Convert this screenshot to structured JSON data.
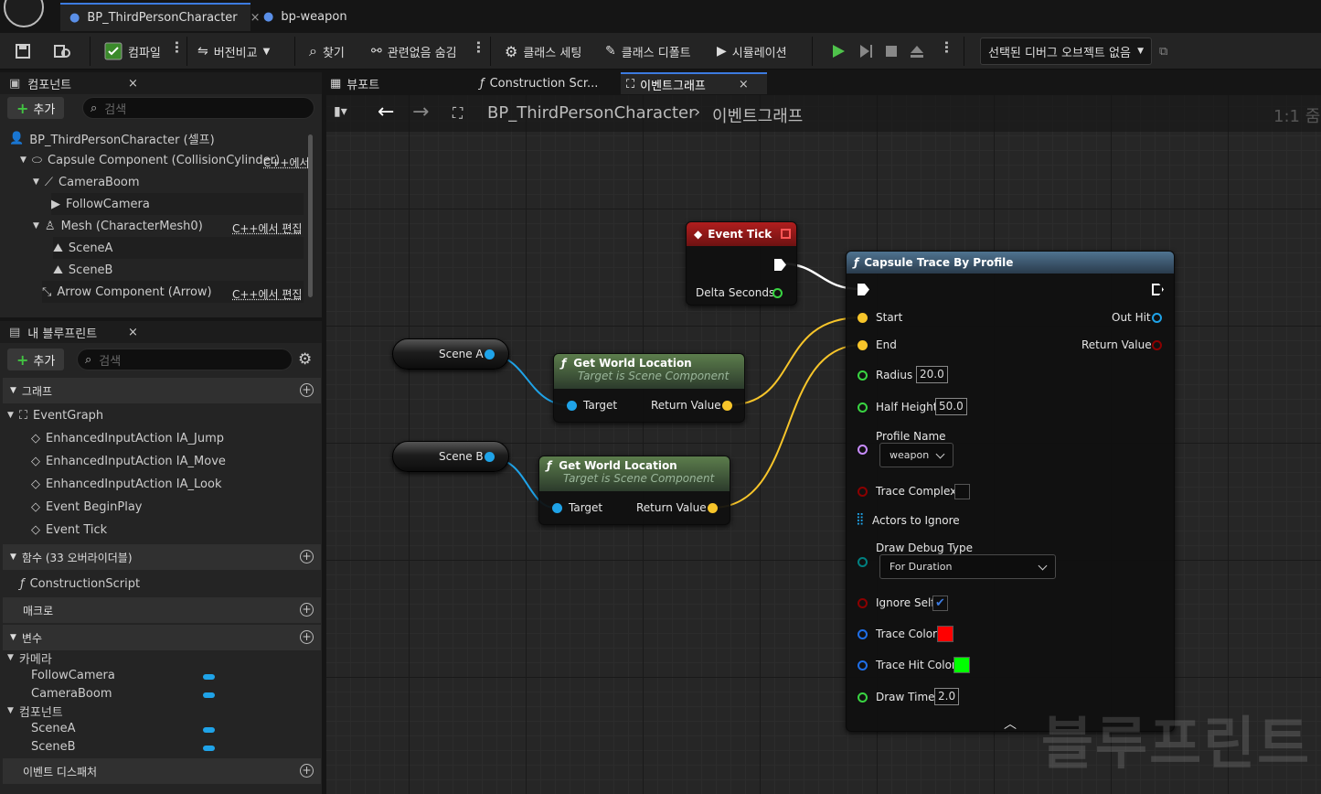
{
  "tabs": [
    {
      "label": "BP_ThirdPersonCharacter",
      "close": "×"
    },
    {
      "label": "bp-weapon"
    }
  ],
  "toolbar": {
    "compile": "컴파일",
    "diff": "버전비교",
    "find": "찾기",
    "hide_unrelated": "관련없음 숨김",
    "class_settings": "클래스 세팅",
    "class_defaults": "클래스 디폴트",
    "simulation": "시뮬레이션",
    "debug_object": "선택된 디버그 오브젝트 없음"
  },
  "components_panel": {
    "title": "컴포넌트",
    "add": "추가",
    "search_placeholder": "검색",
    "items": [
      {
        "label": "BP_ThirdPersonCharacter (셀프)"
      },
      {
        "label": "Capsule Component (CollisionCylinder)",
        "edit": "C++에서"
      },
      {
        "label": "CameraBoom"
      },
      {
        "label": "FollowCamera"
      },
      {
        "label": "Mesh (CharacterMesh0)",
        "edit": "C++에서 편집"
      },
      {
        "label": "SceneA"
      },
      {
        "label": "SceneB"
      },
      {
        "label": "Arrow Component (Arrow)",
        "edit": "C++에서 편집"
      }
    ]
  },
  "my_blueprint": {
    "title": "내 블루프린트",
    "add": "추가",
    "search_placeholder": "검색",
    "graphs_section": "그래프",
    "event_graph": "EventGraph",
    "events": [
      "EnhancedInputAction IA_Jump",
      "EnhancedInputAction IA_Move",
      "EnhancedInputAction IA_Look",
      "Event BeginPlay",
      "Event Tick"
    ],
    "functions_section": "함수 (33 오버라이더블)",
    "construction_script": "ConstructionScript",
    "macros_section": "매크로",
    "variables_section": "변수",
    "categories": [
      {
        "name": "카메라",
        "vars": [
          "FollowCamera",
          "CameraBoom"
        ]
      },
      {
        "name": "컴포넌트",
        "vars": [
          "SceneA",
          "SceneB"
        ]
      }
    ],
    "dispatchers_section": "이벤트 디스패처"
  },
  "editor_tabs": [
    "뷰포트",
    "Construction Scr...",
    "이벤트그래프"
  ],
  "breadcrumb": {
    "root": "BP_ThirdPersonCharacter",
    "current": "이벤트그래프",
    "zoom": "1:1 줌"
  },
  "watermark": "블루프린트",
  "nodes": {
    "event_tick": {
      "title": "Event Tick",
      "pin": "Delta Seconds"
    },
    "scene_a": "Scene A",
    "scene_b": "Scene B",
    "gwl": {
      "title": "Get World Location",
      "subtitle": "Target is Scene Component",
      "target": "Target",
      "ret": "Return Value"
    },
    "capsule": {
      "title": "Capsule Trace By Profile",
      "start": "Start",
      "end": "End",
      "out_hit": "Out Hit",
      "return_value": "Return Value",
      "radius_label": "Radius",
      "radius": "20.0",
      "half_height_label": "Half Height",
      "half_height": "50.0",
      "profile_label": "Profile Name",
      "profile": "weapon",
      "trace_complex": "Trace Complex",
      "actors_ignore": "Actors to Ignore",
      "debug_type_label": "Draw Debug Type",
      "debug_type": "For Duration",
      "ignore_self": "Ignore Self",
      "trace_color": "Trace Color",
      "trace_hit_color": "Trace Hit Color",
      "draw_time_label": "Draw Time",
      "draw_time": "2.0"
    }
  },
  "colors": {
    "accent": "#3c7be0",
    "exec": "#ffffff",
    "vector_pin": "#f7c52a",
    "object_pin": "#1fa3e8",
    "float_pin": "#39d442",
    "name_pin": "#c88cff",
    "bool_pin": "#8b0000",
    "trace_color": "#ff0000",
    "trace_hit_color": "#00ff00"
  }
}
